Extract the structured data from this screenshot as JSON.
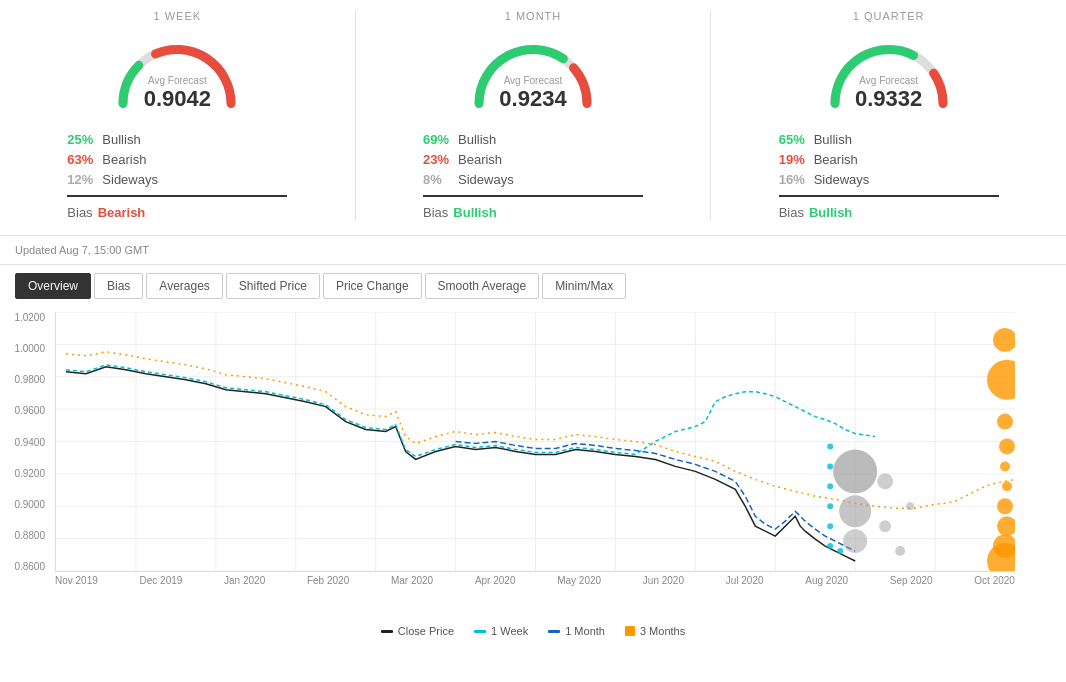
{
  "periods": [
    {
      "id": "week",
      "label": "1 WEEK",
      "forecast_label": "Avg Forecast",
      "forecast_value": "0.9042",
      "gauge_green_pct": 25,
      "gauge_red_pct": 63,
      "bullish_pct": "25%",
      "bearish_pct": "63%",
      "sideways_pct": "12%",
      "bullish_label": "Bullish",
      "bearish_label": "Bearish",
      "sideways_label": "Sideways",
      "bias_prefix": "Bias",
      "bias_value": "Bearish",
      "bias_class": "bearish"
    },
    {
      "id": "month",
      "label": "1 MONTH",
      "forecast_label": "Avg Forecast",
      "forecast_value": "0.9234",
      "gauge_green_pct": 69,
      "gauge_red_pct": 23,
      "bullish_pct": "69%",
      "bearish_pct": "23%",
      "sideways_pct": "8%",
      "bullish_label": "Bullish",
      "bearish_label": "Bearish",
      "sideways_label": "Sideways",
      "bias_prefix": "Bias",
      "bias_value": "Bullish",
      "bias_class": "bullish"
    },
    {
      "id": "quarter",
      "label": "1 QUARTER",
      "forecast_label": "Avg Forecast",
      "forecast_value": "0.9332",
      "gauge_green_pct": 65,
      "gauge_red_pct": 19,
      "bullish_pct": "65%",
      "bearish_pct": "19%",
      "sideways_pct": "16%",
      "bullish_label": "Bullish",
      "bearish_label": "Bearish",
      "sideways_label": "Sideways",
      "bias_prefix": "Bias",
      "bias_value": "Bullish",
      "bias_class": "bullish"
    }
  ],
  "update_text": "Updated Aug 7, 15:00 GMT",
  "tabs": [
    {
      "id": "overview",
      "label": "Overview",
      "active": true
    },
    {
      "id": "bias",
      "label": "Bias",
      "active": false
    },
    {
      "id": "averages",
      "label": "Averages",
      "active": false
    },
    {
      "id": "shifted",
      "label": "Shifted Price",
      "active": false
    },
    {
      "id": "pricechange",
      "label": "Price Change",
      "active": false
    },
    {
      "id": "smooth",
      "label": "Smooth Average",
      "active": false
    },
    {
      "id": "minmax",
      "label": "Minim/Max",
      "active": false
    }
  ],
  "y_axis_labels": [
    "1.0200",
    "1.0000",
    "0.9800",
    "0.9600",
    "0.9400",
    "0.9200",
    "0.9000",
    "0.8800",
    "0.8600"
  ],
  "x_axis_labels": [
    "Nov 2019",
    "Dec 2019",
    "Jan 2020",
    "Feb 2020",
    "Mar 2020",
    "Apr 2020",
    "May 2020",
    "Jun 2020",
    "Jul 2020",
    "Aug 2020",
    "Sep 2020",
    "Oct 2020"
  ],
  "legend": [
    {
      "label": "Close Price",
      "color": "#222",
      "type": "line"
    },
    {
      "label": "1 Week",
      "color": "#00bcd4",
      "type": "line"
    },
    {
      "label": "1 Month",
      "color": "#1565c0",
      "type": "line"
    },
    {
      "label": "3 Months",
      "color": "#ff9800",
      "type": "dot"
    }
  ],
  "colors": {
    "green": "#2ecc71",
    "red": "#e74c3c",
    "gray": "#aaa",
    "active_tab_bg": "#333",
    "active_tab_text": "#fff"
  }
}
